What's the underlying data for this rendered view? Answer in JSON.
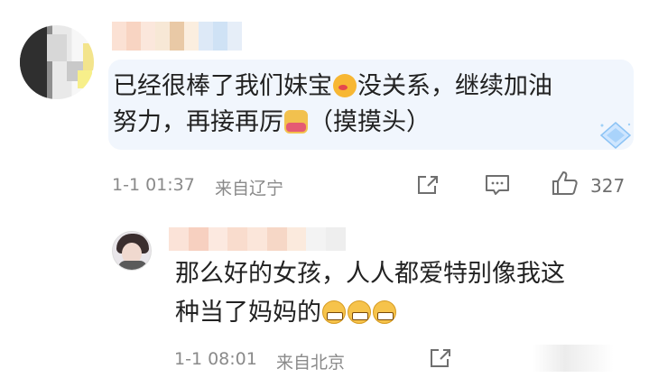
{
  "comment": {
    "text_line1_a": "已经很棒了我们妹宝",
    "text_line1_b": "没关系，继续加油",
    "text_line2_a": "努力，再接再厉",
    "text_line2_b": "（摸摸头）",
    "emoji1": "kiss-face-emoji",
    "emoji2": "pat-head-emoji",
    "time": "1-1 01:37",
    "location": "来自辽宁",
    "like_count": "327"
  },
  "reply": {
    "text_line1": "那么好的女孩，人人都爱特别像我这",
    "text_line2": "种当了妈妈的",
    "emoji": "grinning-face-emoji",
    "emoji_count": 3,
    "time": "1-1 08:01",
    "location": "来自北京"
  },
  "colors": {
    "bubble_bg": "#f1f6fd",
    "meta_text": "#8a8a8a",
    "icon": "#6f6f6f"
  }
}
